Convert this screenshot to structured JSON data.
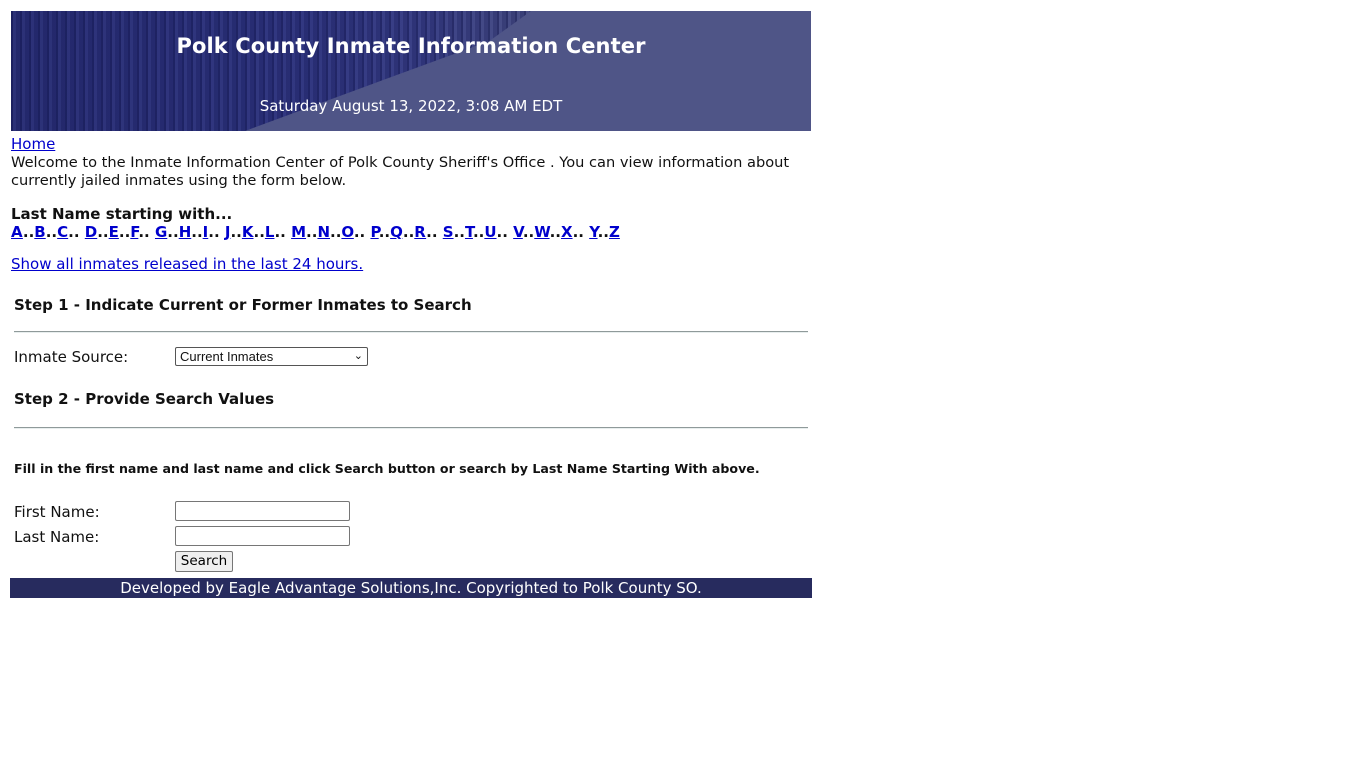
{
  "header": {
    "title": "Polk County Inmate Information Center",
    "datetime": "Saturday August 13, 2022, 3:08 AM EDT"
  },
  "nav": {
    "home_label": "Home"
  },
  "welcome": {
    "line1": "Welcome to the Inmate Information Center of Polk County Sheriff's Office . You can view information about",
    "line2": "currently jailed inmates using the form below."
  },
  "letters": {
    "label": "Last Name starting with...",
    "items": [
      "A",
      "B",
      "C",
      "D",
      "E",
      "F",
      "G",
      "H",
      "I",
      "J",
      "K",
      "L",
      "M",
      "N",
      "O",
      "P",
      "Q",
      "R",
      "S",
      "T",
      "U",
      "V",
      "W",
      "X",
      "Y",
      "Z"
    ]
  },
  "released_link": "Show all inmates released in the last 24 hours.",
  "step1": {
    "heading": "Step 1 - Indicate Current or Former Inmates to Search",
    "source_label": "Inmate Source:",
    "source_selected": "Current Inmates"
  },
  "step2": {
    "heading": "Step 2 - Provide Search Values",
    "instructions": "Fill in the first name and last name and click Search button or search by Last Name Starting With above.",
    "first_name_label": "First Name:",
    "first_name_value": "",
    "last_name_label": "Last Name:",
    "last_name_value": "",
    "search_button": "Search"
  },
  "footer": {
    "text": "Developed by Eagle Advantage Solutions,Inc. Copyrighted to Polk County SO."
  },
  "colors": {
    "banner": "#4f5587",
    "footer": "#272b5e",
    "link": "#0000cc"
  }
}
